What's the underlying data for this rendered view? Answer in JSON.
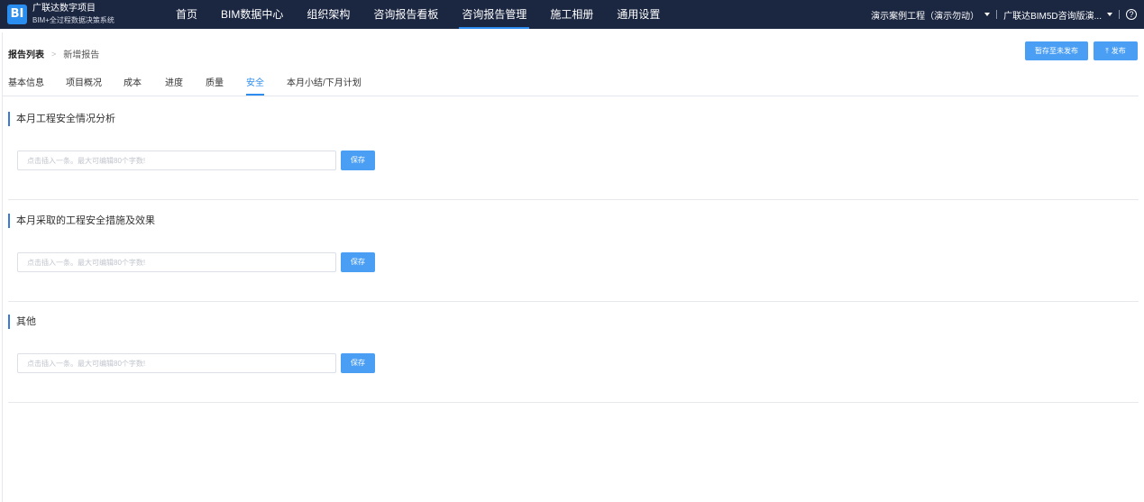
{
  "app": {
    "logo_text": "BI",
    "brand_line1": "广联达数字项目",
    "brand_line2": "BIM+全过程数据决策系统"
  },
  "nav": {
    "items": [
      {
        "label": "首页"
      },
      {
        "label": "BIM数据中心"
      },
      {
        "label": "组织架构"
      },
      {
        "label": "咨询报告看板"
      },
      {
        "label": "咨询报告管理",
        "active": true
      },
      {
        "label": "施工相册"
      },
      {
        "label": "通用设置"
      }
    ]
  },
  "top_right": {
    "project": "演示案例工程（演示勿动）",
    "company": "广联达BIM5D咨询版演...",
    "help": "?"
  },
  "breadcrumb": {
    "root": "报告列表",
    "separator": ">",
    "current": "新增报告"
  },
  "actions": {
    "save_draft": "暂存至未发布",
    "publish_icon": "upload-icon",
    "publish": "发布"
  },
  "tabs": [
    {
      "label": "基本信息"
    },
    {
      "label": "项目概况"
    },
    {
      "label": "成本"
    },
    {
      "label": "进度"
    },
    {
      "label": "质量"
    },
    {
      "label": "安全",
      "active": true
    },
    {
      "label": "本月小结/下月计划"
    }
  ],
  "sections": [
    {
      "title": "本月工程安全情况分析",
      "value": "",
      "placeholder": "点击插入一条。最大可编辑80个字数!",
      "save": "保存"
    },
    {
      "title": "本月采取的工程安全措施及效果",
      "value": "",
      "placeholder": "点击插入一条。最大可编辑80个字数!",
      "save": "保存"
    },
    {
      "title": "其他",
      "value": "",
      "placeholder": "点击插入一条。最大可编辑80个字数!",
      "save": "保存"
    }
  ],
  "colors": {
    "topbar": "#1b2640",
    "primary": "#2d8cf0",
    "button": "#4a9ff5"
  }
}
